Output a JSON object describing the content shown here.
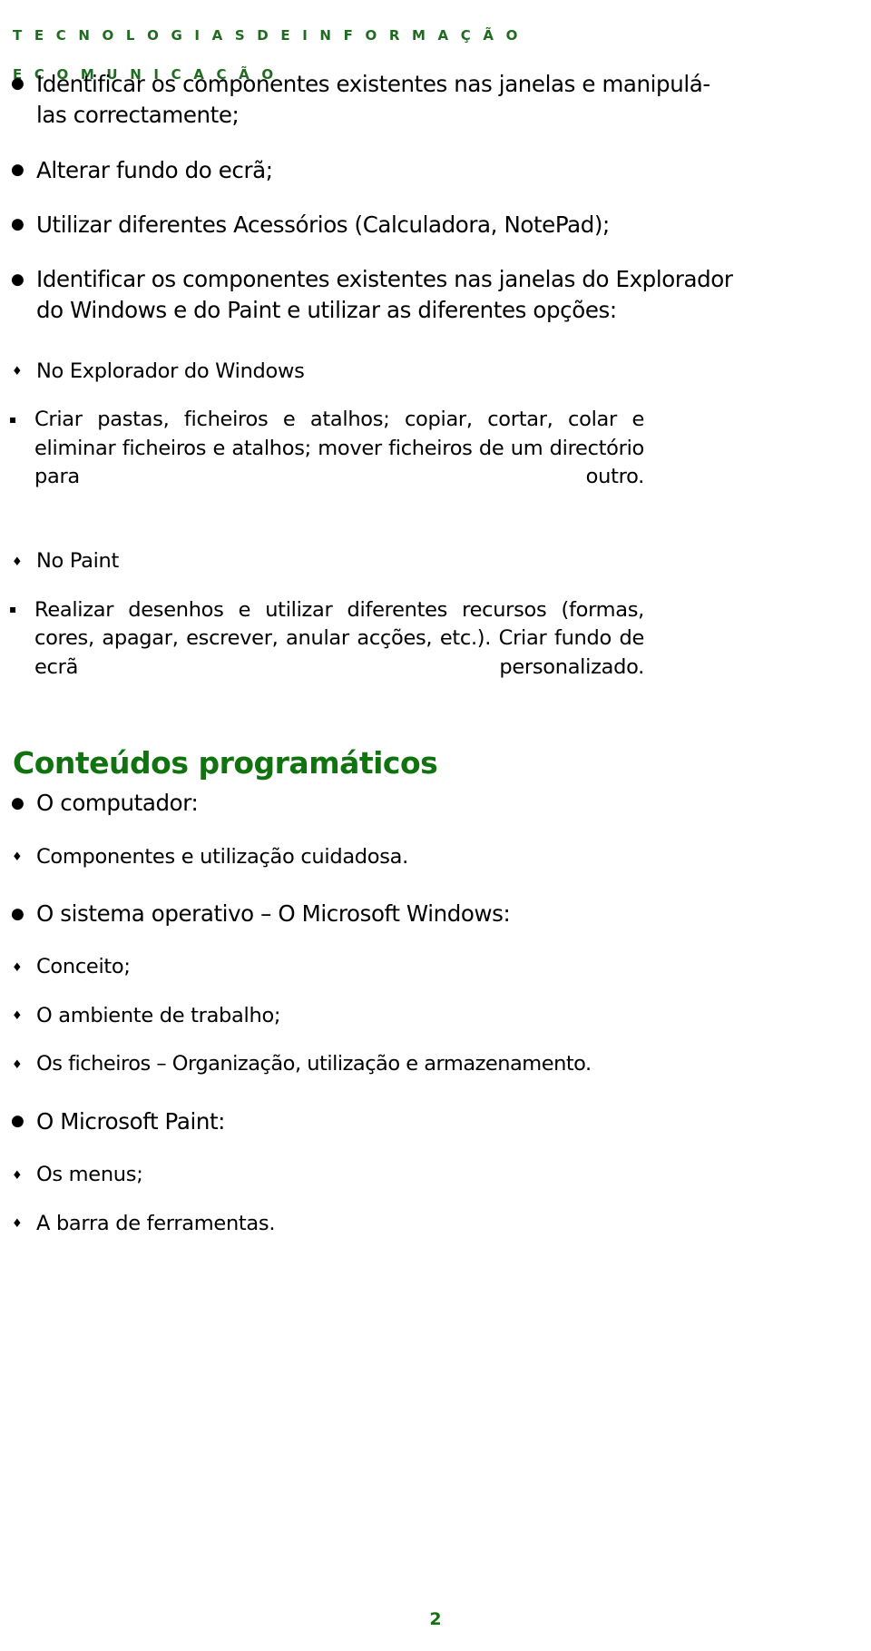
{
  "header": {
    "line1": "T E C N O L O G I A S   D E   I N F O R M A Ç Ã O",
    "line2": "E   C O M U N I C A Ç Ã O",
    "color": "#1f6b1f"
  },
  "objectives": {
    "bullets": [
      {
        "marker": "●",
        "text": "Identificar os componentes existentes nas janelas e manipulá-las correctamente;"
      },
      {
        "marker": "●",
        "text": "Alterar fundo do ecrã;"
      },
      {
        "marker": "●",
        "text": "Utilizar diferentes Acessórios (Calculadora, NotePad);"
      },
      {
        "marker": "●",
        "text": "Identificar os componentes existentes nas janelas do Explorador do Windows e do Paint e utilizar as diferentes opções:"
      }
    ],
    "sub_explorador": {
      "marker": "♦",
      "label": "No Explorador do Windows",
      "detail_marker": "▪",
      "detail": "Criar pastas, ficheiros e atalhos; copiar, cortar, colar e eliminar ficheiros e atalhos; mover ficheiros de um directório para outro."
    },
    "sub_paint": {
      "marker": "♦",
      "label": "No Paint",
      "detail_marker": "▪",
      "detail": "Realizar desenhos e utilizar diferentes recursos (formas, cores, apagar, escrever, anular acções, etc.). Criar fundo de ecrã personalizado."
    }
  },
  "conteudos": {
    "title": "Conteúdos programáticos",
    "title_color": "#11730f",
    "groups": [
      {
        "marker": "●",
        "label": "O computador:",
        "items": [
          {
            "marker": "♦",
            "text": "Componentes e utilização cuidadosa."
          }
        ]
      },
      {
        "marker": "●",
        "label": "O sistema operativo – O Microsoft Windows:",
        "items": [
          {
            "marker": "♦",
            "text": "Conceito;"
          },
          {
            "marker": "♦",
            "text": "O ambiente de trabalho;"
          },
          {
            "marker": "♦",
            "text": "Os ficheiros – Organização, utilização e armazenamento."
          }
        ]
      },
      {
        "marker": "●",
        "label": "O Microsoft Paint:",
        "items": [
          {
            "marker": "♦",
            "text": "Os menus;"
          },
          {
            "marker": "♦",
            "text": "A barra de ferramentas."
          }
        ]
      }
    ]
  },
  "footer": {
    "page_number": "2"
  }
}
